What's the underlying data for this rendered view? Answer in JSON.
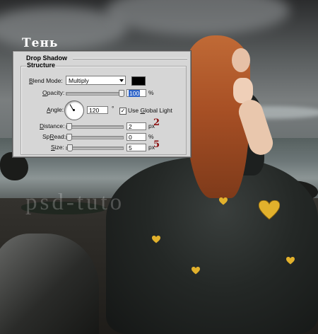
{
  "caption": "Тень",
  "watermark": "psd-tuto",
  "dialog": {
    "title": "Drop Shadow",
    "group": "Structure",
    "blend_mode": {
      "label_underlined": "B",
      "label_rest": "lend Mode:",
      "value": "Multiply",
      "color": "#000000"
    },
    "opacity": {
      "label_underlined": "O",
      "label_rest": "pacity:",
      "value": "100",
      "unit": "%",
      "level": 1.0
    },
    "angle": {
      "label_underlined": "A",
      "label_rest": "ngle:",
      "value": "120",
      "unit": "°",
      "use_global_light_underlined": "G",
      "use_global_light_pre": "Use ",
      "use_global_light_post": "lobal Light",
      "use_global_light_checked": true
    },
    "distance": {
      "label_underlined": "D",
      "label_rest": "istance:",
      "value": "2",
      "unit": "px",
      "level": 0.0
    },
    "spread": {
      "label_underlined": "R",
      "label_rest": "Sp",
      "label_post": "ead:",
      "value": "0",
      "unit": "%",
      "level": 0.0
    },
    "size": {
      "label_underlined": "S",
      "label_rest": "ize:",
      "value": "5",
      "unit": "px",
      "level": 0.02
    }
  },
  "annotations": {
    "distance": "2",
    "size": "5"
  },
  "colors": {
    "annotation": "#8b1010",
    "dialog_bg": "#d6d6d6",
    "selection": "#2d63c8",
    "accent_gold": "#e2b12c"
  }
}
